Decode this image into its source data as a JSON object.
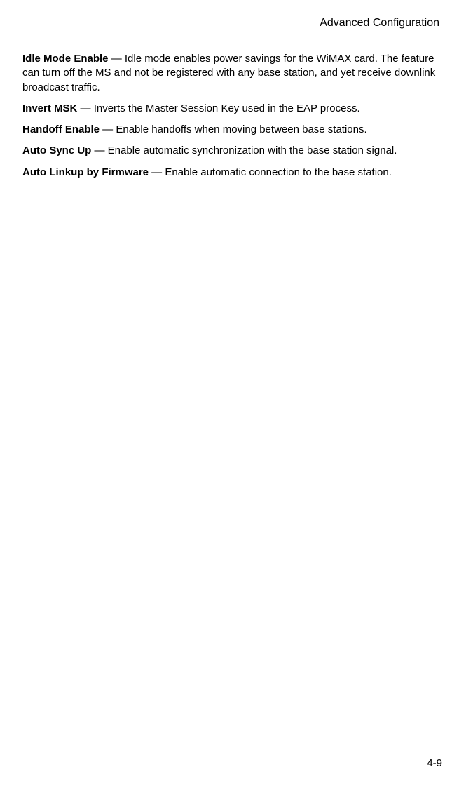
{
  "header": {
    "title": "Advanced Configuration"
  },
  "entries": [
    {
      "term": "Idle Mode Enable",
      "desc": " — Idle mode enables power savings for the WiMAX card. The feature can turn off the MS and not be registered with any base station, and yet receive downlink broadcast traffic."
    },
    {
      "term": "Invert MSK",
      "desc": " — Inverts the Master Session Key used in the EAP process."
    },
    {
      "term": "Handoff Enable",
      "desc": " — Enable handoffs when moving between base stations."
    },
    {
      "term": "Auto Sync Up",
      "desc": " — Enable automatic synchronization with the base station signal."
    },
    {
      "term": "Auto Linkup by Firmware",
      "desc": " — Enable automatic connection to the base station."
    }
  ],
  "footer": {
    "page_number": "4-9"
  }
}
